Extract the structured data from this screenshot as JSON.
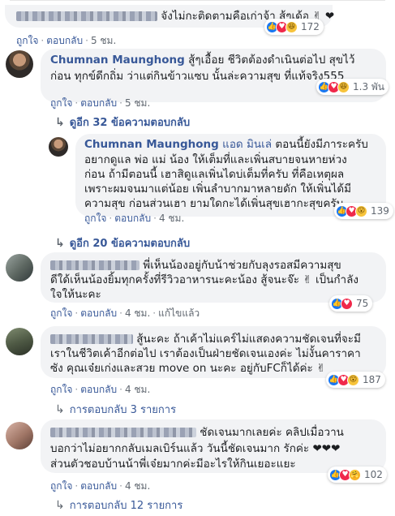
{
  "colors": {
    "link": "#385898",
    "bubble": "#f2f3f5",
    "like": "#1877f2",
    "love": "#f0284a"
  },
  "actions": {
    "like": "ถูกใจ",
    "reply": "ตอบกลับ",
    "edit": "แก้ไขแล้ว"
  },
  "comments": [
    {
      "lines": [
        "จังไม่กะติดตามคือเก่าจ้า สู้ๆเด้อ ✌ ❤"
      ],
      "time": "5 ชม.",
      "reactions": {
        "icons": [
          "like-icon",
          "love-icon",
          "haha-icon"
        ],
        "count": "172"
      }
    },
    {
      "name": "Chumnan Maunghong",
      "lines": [
        "สู้ๆเอื้อย ชีวิตต้องดำเนินต่อไป สุขไว้",
        "ก่อน ทุกข์ดีกถิ่ม ว่าแต่กินข้าวแซบ นั้นล่ะความสุข ที่แท้จริง555"
      ],
      "time": "5 ชม.",
      "reactions": {
        "icons": [
          "like-icon",
          "love-icon",
          "haha-icon"
        ],
        "count": "1.3 พัน"
      },
      "more_replies": "ดูอีก 32 ข้อความตอบกลับ"
    },
    {
      "name": "Chumnan Maunghong",
      "badge": "แอด มินเล่",
      "lines": [
        "ตอนนี้ยังมีภาระครับ",
        "อยากดูแล พ่อ แม่ น้อง ให้เต็มที่และเพิ่นสบายจนหายห่วง",
        "ก่อน ถ้ามีตอนนี้ เฮาสิดูแลเพิ่นไดบ่เต็มที่ครับ ที่คือเหตุผล",
        "เพราะผมจนมาแต่น้อย เพิ่นลำบากมาหลายดัก ให้เพิ่นได้มี",
        "ความสุข ก่อนส่วนเฮา ยามใดกะได้เพิ่นสุขเฮากะสุขครับ"
      ],
      "time": "4 ชม.",
      "reactions": {
        "icons": [
          "like-icon",
          "love-icon",
          "wow-icon"
        ],
        "count": "139"
      },
      "more_replies": "ดูอีก 20 ข้อความตอบกลับ"
    },
    {
      "lines": [
        "พี่เห็นน้องอยู่กับน้าช่วยกับลุงรอสมีความสุข",
        "ดีใด้เห็นน้องยิ้มทุกครั้งที่รีวิวอาหารนะคะน้อง สู้จนะจ๊ะ ✌ เป็นกำลัง",
        "ใจให้นะคะ"
      ],
      "time": "4 ชม.",
      "edited": true,
      "reactions": {
        "icons": [
          "like-icon",
          "love-icon"
        ],
        "count": "75"
      }
    },
    {
      "lines": [
        "สู้นะคะ ถ้าเค้าไม่แคร์ไม่แสดงความชัดเจนที่จะมี",
        "เราในชีวิตเค้าอีกต่อไป เราต้องเป็นฝ่ายชัดเจนเองค่ะ ไม่งั้นคาราคา",
        "ซัง คุณเจ๋ยเก่งและสวย move on นะคะ อยู่กับFCก็ได้ค่ะ ✌"
      ],
      "time": "4 ชม.",
      "reactions": {
        "icons": [
          "like-icon",
          "love-icon",
          "wow-icon"
        ],
        "count": "187"
      },
      "more_replies": "การตอบกลับ 3 รายการ"
    },
    {
      "lines": [
        "ชัดเจนมากเลยค่ะ คลิปเมื่อวาน",
        "บอกว่าไม่อยากกลับเมลเบิร์นแล้ว วันนี้ชัดเจนมาก รักค่ะ ❤❤❤",
        "ส่วนตัวชอบบ้านน้าพี่เจ๋ยมากค่ะมีอะไรให้กินเยอะแยะ"
      ],
      "time": "4 ชม.",
      "reactions": {
        "icons": [
          "like-icon",
          "love-icon",
          "care-icon"
        ],
        "count": "102"
      },
      "more_replies": "การตอบกลับ 12 รายการ"
    }
  ]
}
